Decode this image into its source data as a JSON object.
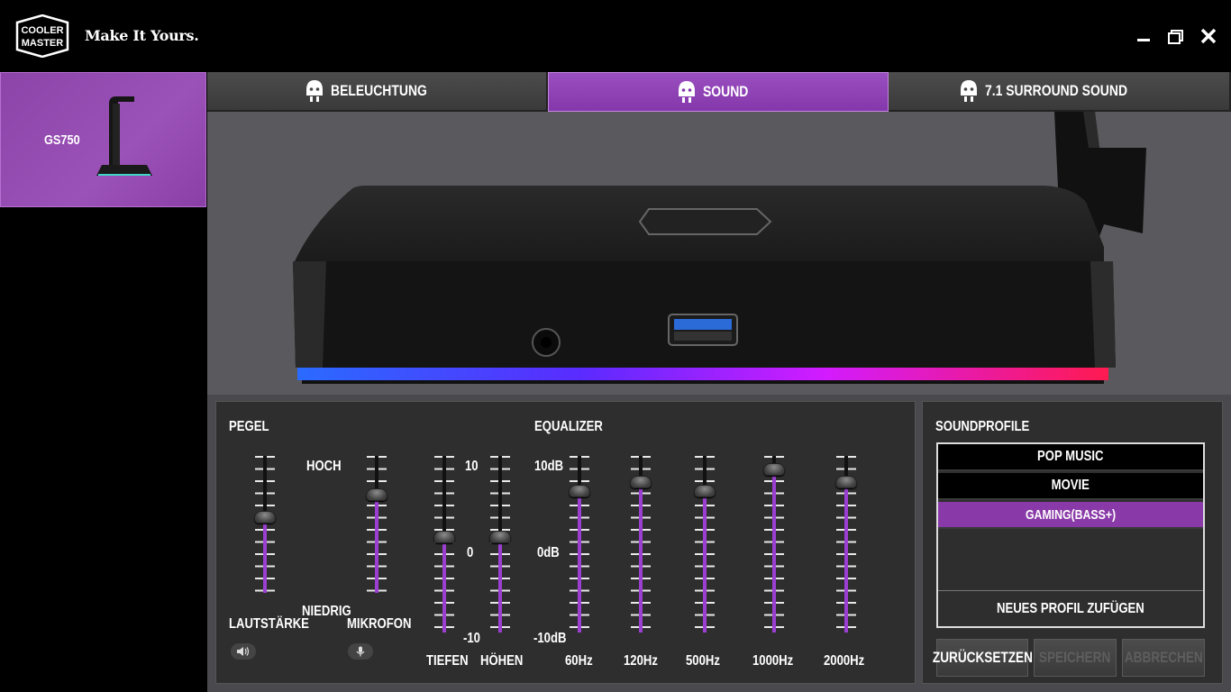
{
  "app": {
    "logo_text": [
      "COOLER",
      "MASTER"
    ],
    "tagline": "Make It Yours.",
    "window_controls": [
      "minimize-icon",
      "maximize-icon",
      "close-icon"
    ]
  },
  "sidebar": {
    "device": {
      "name": "GS750",
      "selected": true
    }
  },
  "tabs": [
    {
      "label": "BELEUCHTUNG",
      "icon": "headset-stand-icon",
      "active": false
    },
    {
      "label": "SOUND",
      "icon": "headset-stand-icon",
      "active": true
    },
    {
      "label": "7.1 SURROUND SOUND",
      "icon": "headset-stand-icon",
      "active": false
    }
  ],
  "pegel": {
    "title": "PEGEL",
    "high_label": "HOCH",
    "low_label": "NIEDRIG",
    "volume": {
      "label": "LAUTSTÄRKE",
      "icon": "speaker-icon",
      "level": 0.55
    },
    "mic": {
      "label": "MIKROFON",
      "icon": "microphone-icon",
      "level": 0.72
    }
  },
  "tone": {
    "scale_top": "10",
    "scale_mid": "0",
    "scale_bottom": "-10",
    "bass": {
      "label": "TIEFEN",
      "value": 0
    },
    "treble": {
      "label": "HÖHEN",
      "value": 0
    }
  },
  "equalizer": {
    "title": "EQUALIZER",
    "scale_top": "10dB",
    "scale_mid": "0dB",
    "scale_bottom": "-10dB",
    "bands": [
      {
        "label": "60Hz",
        "db": 6
      },
      {
        "label": "120Hz",
        "db": 7
      },
      {
        "label": "500Hz",
        "db": 6
      },
      {
        "label": "1000Hz",
        "db": 8.5
      },
      {
        "label": "2000Hz",
        "db": 7
      }
    ]
  },
  "soundprofile": {
    "title": "SOUNDPROFILE",
    "profiles": [
      {
        "label": "POP MUSIC",
        "selected": false
      },
      {
        "label": "MOVIE",
        "selected": false
      },
      {
        "label": "GAMING(BASS+)",
        "selected": true
      }
    ],
    "add_label": "NEUES PROFIL ZUFÜGEN",
    "buttons": {
      "reset": "ZURÜCKSETZEN",
      "save": "SPEICHERN",
      "cancel": "ABBRECHEN"
    }
  },
  "colors": {
    "accent": "#8a3aa8",
    "slider_fill": "#9a3fd0",
    "rgb_strip_start": "#2a6bff",
    "rgb_strip_end": "#ff1a50"
  }
}
